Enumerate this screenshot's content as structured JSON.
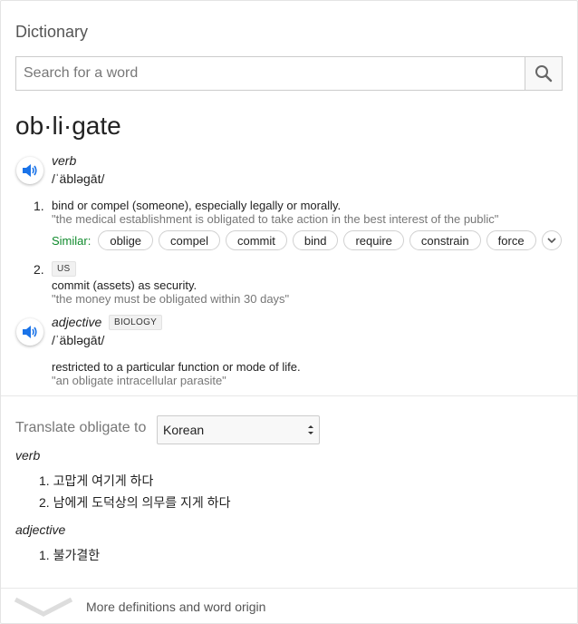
{
  "title": "Dictionary",
  "search": {
    "placeholder": "Search for a word"
  },
  "headword": "ob·li·gate",
  "entries": [
    {
      "pos": "verb",
      "phonetic": "/ˈäbləɡāt/",
      "senses": [
        {
          "number": "1.",
          "definition": "bind or compel (someone), especially legally or morally.",
          "example": "\"the medical establishment is obligated to take action in the best interest of the public\"",
          "similar_label": "Similar:",
          "similar": [
            "oblige",
            "compel",
            "commit",
            "bind",
            "require",
            "constrain",
            "force"
          ]
        },
        {
          "number": "2.",
          "label": "US",
          "definition": "commit (assets) as security.",
          "example": "\"the money must be obligated within 30 days\""
        }
      ]
    },
    {
      "pos": "adjective",
      "label": "BIOLOGY",
      "phonetic": "/ˈäbləɡāt/",
      "senses": [
        {
          "definition": "restricted to a particular function or mode of life.",
          "example": "\"an obligate intracellular parasite\""
        }
      ]
    }
  ],
  "translate": {
    "label": "Translate obligate to",
    "language": "Korean",
    "groups": [
      {
        "pos": "verb",
        "items": [
          "1.  고맙게 여기게 하다",
          "2.  남에게 도덕상의 의무를 지게 하다"
        ]
      },
      {
        "pos": "adjective",
        "items": [
          "1.  불가결한"
        ]
      }
    ]
  },
  "more_link": "More definitions and word origin",
  "colors": {
    "similar_label": "#0f8a2c",
    "speaker_icon": "#1a73e8"
  }
}
